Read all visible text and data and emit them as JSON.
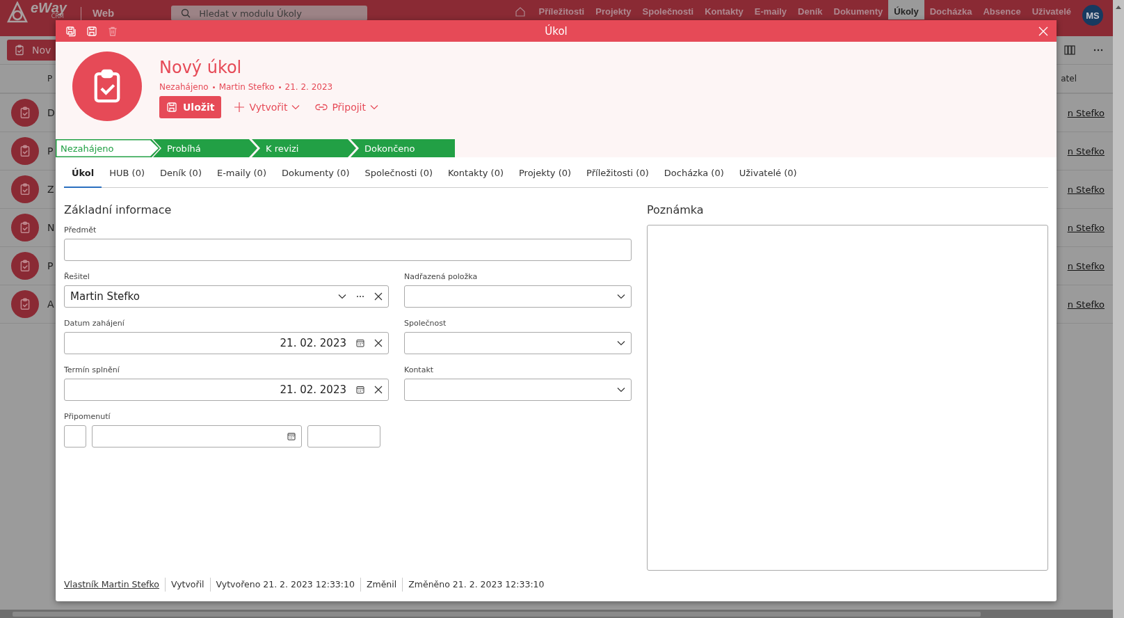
{
  "app": {
    "logo": "eWay",
    "logo_sub": "CRM",
    "section": "Web",
    "search": {
      "placeholder": "Hledat v modulu Úkoly"
    },
    "nav": [
      {
        "label": "Příležitosti",
        "selected": false
      },
      {
        "label": "Projekty",
        "selected": false
      },
      {
        "label": "Společnosti",
        "selected": false
      },
      {
        "label": "Kontakty",
        "selected": false
      },
      {
        "label": "E-maily",
        "selected": false
      },
      {
        "label": "Deník",
        "selected": false
      },
      {
        "label": "Dokumenty",
        "selected": false
      },
      {
        "label": "Úkoly",
        "selected": true
      },
      {
        "label": "Docházka",
        "selected": false
      },
      {
        "label": "Absence",
        "selected": false
      },
      {
        "label": "Uživatelé",
        "selected": false
      }
    ],
    "avatar": "MS"
  },
  "toolbar": {
    "new_button": "Nov"
  },
  "list": {
    "header": {
      "column_1": "P",
      "column_2": "atel"
    },
    "rows": [
      {
        "column_1": "D",
        "column_2": "n Stefko"
      },
      {
        "column_1": "P",
        "column_2": "n Stefko"
      },
      {
        "column_1": "Z",
        "column_2": "n Stefko"
      },
      {
        "column_1": "N",
        "column_2": "n Stefko"
      },
      {
        "column_1": "P",
        "column_2": "n Stefko"
      },
      {
        "column_1": "A",
        "column_2": "n Stefko"
      }
    ]
  },
  "dialog": {
    "title": "Úkol",
    "actions": [
      {
        "kind": "save-close",
        "disabled": false
      },
      {
        "kind": "save",
        "disabled": false
      },
      {
        "kind": "delete",
        "disabled": true
      }
    ],
    "header": {
      "title": "Nový úkol",
      "meta": [
        "Nezahájeno",
        "Martin Stefko",
        "21. 2. 2023"
      ],
      "save_button": "Uložit",
      "create_button": "Vytvořit",
      "attach_button": "Připojit"
    },
    "stages": [
      {
        "label": "Nezahájeno",
        "selected": true
      },
      {
        "label": "Probíhá",
        "selected": false
      },
      {
        "label": "K revizi",
        "selected": false
      },
      {
        "label": "Dokončeno",
        "selected": false
      }
    ],
    "tabs": [
      {
        "label": "Úkol",
        "selected": true
      },
      {
        "label": "HUB (0)",
        "selected": false
      },
      {
        "label": "Deník (0)",
        "selected": false
      },
      {
        "label": "E-maily (0)",
        "selected": false
      },
      {
        "label": "Dokumenty (0)",
        "selected": false
      },
      {
        "label": "Společnosti (0)",
        "selected": false
      },
      {
        "label": "Kontakty (0)",
        "selected": false
      },
      {
        "label": "Projekty (0)",
        "selected": false
      },
      {
        "label": "Příležitosti (0)",
        "selected": false
      },
      {
        "label": "Docházka (0)",
        "selected": false
      },
      {
        "label": "Uživatelé (0)",
        "selected": false
      }
    ],
    "section_title": "Základní informace",
    "subject": {
      "label": "Předmět"
    },
    "resolver": {
      "label": "Řešitel",
      "value": "Martin Stefko"
    },
    "parent": {
      "label": "Nadřazená položka"
    },
    "start": {
      "label": "Datum zahájení",
      "value": "21. 02. 2023"
    },
    "company": {
      "label": "Společnost"
    },
    "due": {
      "label": "Termín splnění",
      "value": "21. 02. 2023"
    },
    "contact": {
      "label": "Kontakt"
    },
    "reminder": {
      "label": "Připomenutí"
    },
    "note": {
      "label": "Poznámka"
    },
    "footer": [
      {
        "kind": "link",
        "text": "Vlastník Martin Stefko"
      },
      {
        "kind": "text",
        "text": "Vytvořil"
      },
      {
        "kind": "text",
        "text": "Vytvořeno 21. 2. 2023 12:33:10"
      },
      {
        "kind": "text",
        "text": "Změnil"
      },
      {
        "kind": "text",
        "text": "Změněno 21. 2. 2023 12:33:10"
      }
    ]
  }
}
